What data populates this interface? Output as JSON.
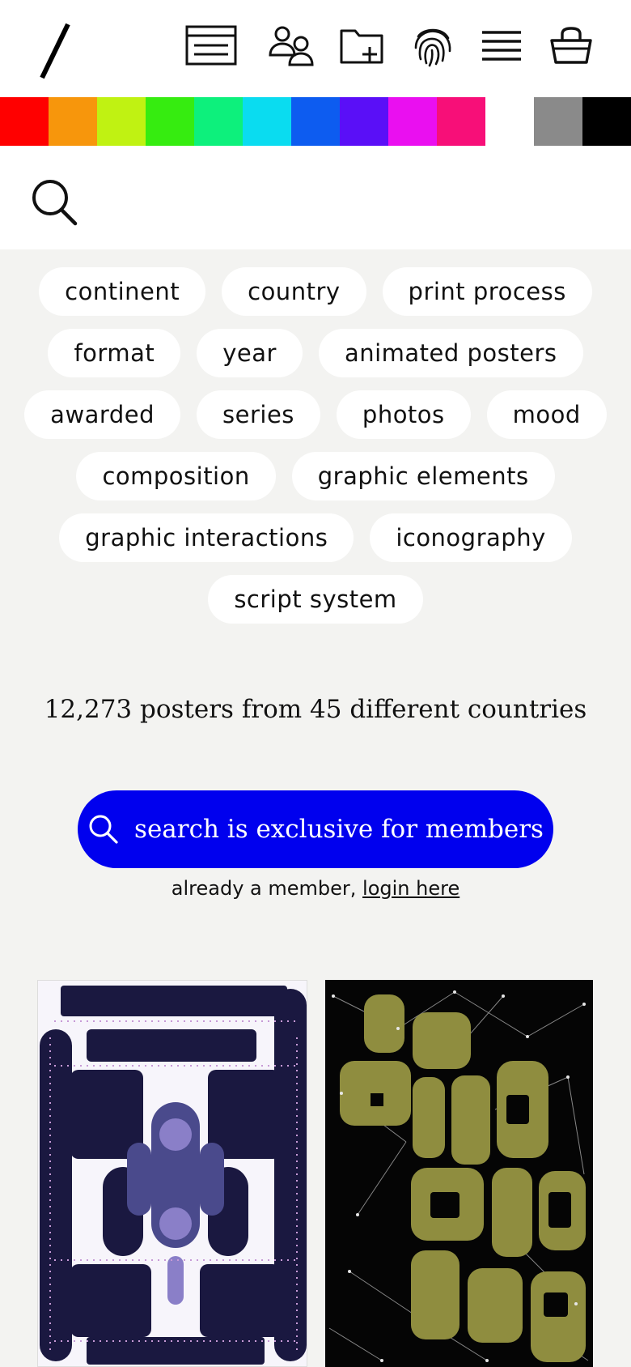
{
  "header": {
    "logo": "slash-logo",
    "icons": [
      "membership-card-icon",
      "users-icon",
      "folder-add-icon",
      "fingerprint-icon",
      "menu-icon",
      "basket-icon"
    ]
  },
  "color_filter": {
    "swatches": [
      "#ff0000",
      "#f7960c",
      "#c0f212",
      "#36ec10",
      "#0df07c",
      "#0adcf0",
      "#0d5cf0",
      "#5a0ff7",
      "#ea0ff0",
      "#f70f78",
      "#ffffff",
      "#8a8a8a",
      "#000000"
    ]
  },
  "filters": {
    "rows": [
      [
        "continent",
        "country",
        "print process"
      ],
      [
        "format",
        "year",
        "animated posters"
      ],
      [
        "awarded",
        "series",
        "photos",
        "mood"
      ],
      [
        "composition",
        "graphic elements"
      ],
      [
        "graphic interactions",
        "iconography"
      ],
      [
        "script system"
      ]
    ]
  },
  "stats": {
    "text": "12,273 posters from 45 different countries"
  },
  "cta": {
    "label": "search is exclusive for members",
    "accent": "#0000ee"
  },
  "member": {
    "prefix": "already a member, ",
    "link": "login here"
  }
}
